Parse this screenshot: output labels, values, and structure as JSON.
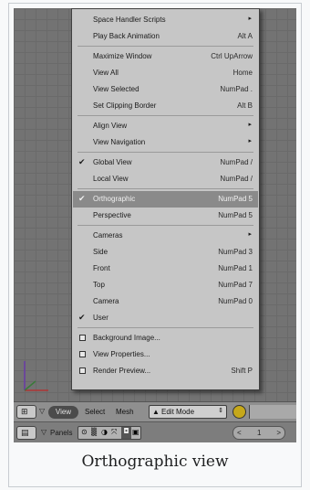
{
  "menu": {
    "items": [
      {
        "label": "Space Handler Scripts",
        "shortcut": "",
        "submenu": true,
        "check": false,
        "box": false
      },
      {
        "label": "Play Back Animation",
        "shortcut": "Alt A",
        "submenu": false,
        "check": false,
        "box": false
      },
      {
        "label": "Maximize Window",
        "shortcut": "Ctrl UpArrow",
        "submenu": false,
        "check": false,
        "box": false
      },
      {
        "label": "View All",
        "shortcut": "Home",
        "submenu": false,
        "check": false,
        "box": false
      },
      {
        "label": "View Selected",
        "shortcut": "NumPad .",
        "submenu": false,
        "check": false,
        "box": false
      },
      {
        "label": "Set Clipping Border",
        "shortcut": "Alt B",
        "submenu": false,
        "check": false,
        "box": false
      },
      {
        "label": "Align View",
        "shortcut": "",
        "submenu": true,
        "check": false,
        "box": false
      },
      {
        "label": "View Navigation",
        "shortcut": "",
        "submenu": true,
        "check": false,
        "box": false
      },
      {
        "label": "Global View",
        "shortcut": "NumPad /",
        "submenu": false,
        "check": true,
        "box": false
      },
      {
        "label": "Local View",
        "shortcut": "NumPad /",
        "submenu": false,
        "check": false,
        "box": false
      },
      {
        "label": "Orthographic",
        "shortcut": "NumPad 5",
        "submenu": false,
        "check": true,
        "box": false,
        "highlighted": true
      },
      {
        "label": "Perspective",
        "shortcut": "NumPad 5",
        "submenu": false,
        "check": false,
        "box": false
      },
      {
        "label": "Cameras",
        "shortcut": "",
        "submenu": true,
        "check": false,
        "box": false
      },
      {
        "label": "Side",
        "shortcut": "NumPad 3",
        "submenu": false,
        "check": false,
        "box": false
      },
      {
        "label": "Front",
        "shortcut": "NumPad 1",
        "submenu": false,
        "check": false,
        "box": false
      },
      {
        "label": "Top",
        "shortcut": "NumPad 7",
        "submenu": false,
        "check": false,
        "box": false
      },
      {
        "label": "Camera",
        "shortcut": "NumPad 0",
        "submenu": false,
        "check": false,
        "box": false
      },
      {
        "label": "User",
        "shortcut": "",
        "submenu": false,
        "check": true,
        "box": false
      },
      {
        "label": "Background Image...",
        "shortcut": "",
        "submenu": false,
        "check": false,
        "box": true
      },
      {
        "label": "View Properties...",
        "shortcut": "",
        "submenu": false,
        "check": false,
        "box": true
      },
      {
        "label": "Render Preview...",
        "shortcut": "Shift P",
        "submenu": false,
        "check": false,
        "box": true
      }
    ]
  },
  "header": {
    "view_label": "View",
    "select_label": "Select",
    "mesh_label": "Mesh",
    "mode_label": "Edit Mode",
    "panels_label": "Panels",
    "frame_value": "1"
  },
  "caption": "Orthographic view",
  "colors": {
    "menu_bg": "#c6c6c6",
    "highlight": "#8a8a8a",
    "viewport_bg": "#737373",
    "header_bg": "#8f8f8f"
  }
}
